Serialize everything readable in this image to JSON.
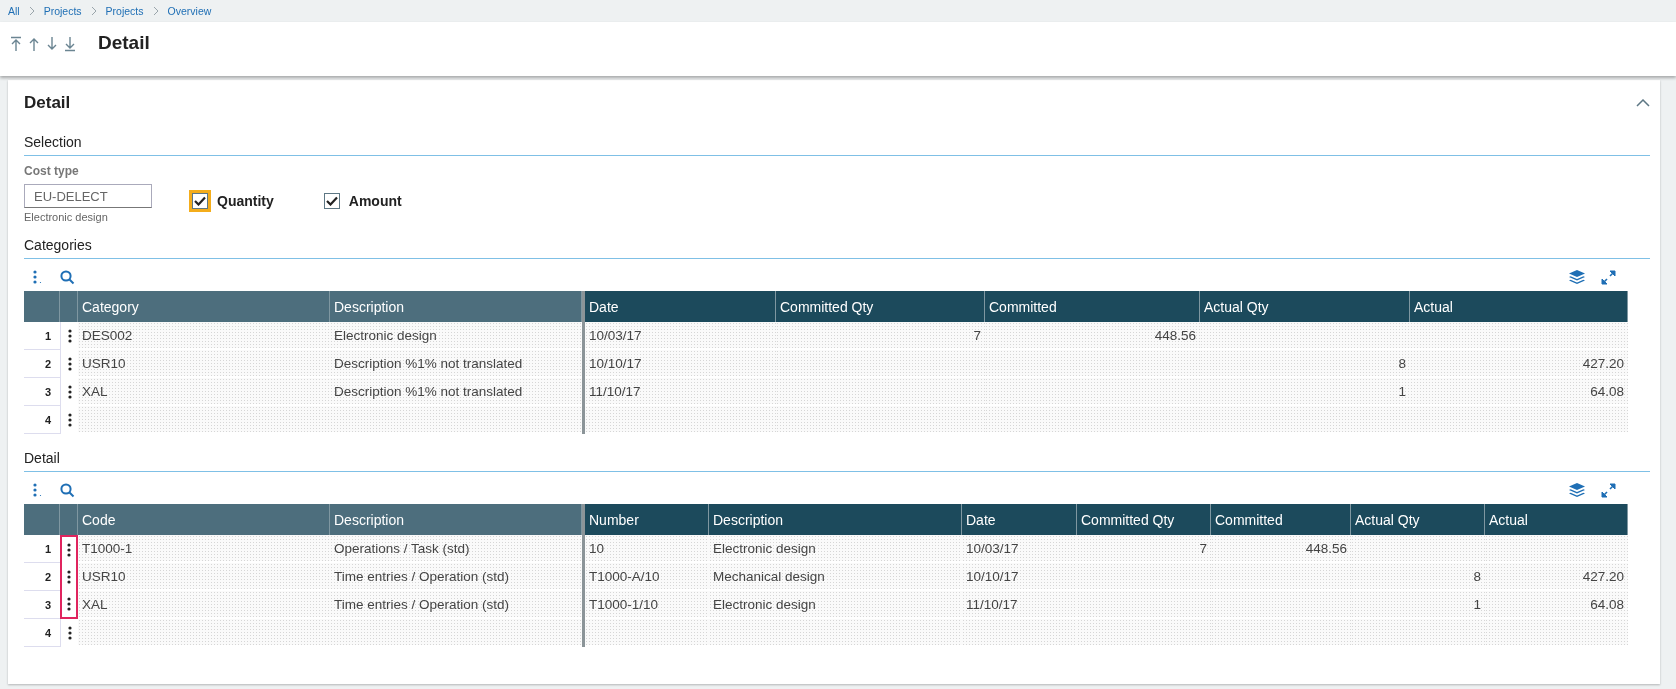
{
  "breadcrumbs": [
    "All",
    "Projects",
    "Projects",
    "Overview"
  ],
  "header": {
    "title": "Detail"
  },
  "section": {
    "title": "Detail",
    "expanded": true,
    "selection": {
      "heading": "Selection",
      "cost_type": {
        "label": "Cost type",
        "value": "EU-DELECT",
        "description": "Electronic design"
      },
      "checkboxes": [
        {
          "label": "Quantity",
          "checked": true,
          "focused": true
        },
        {
          "label": "Amount",
          "checked": true,
          "focused": false
        }
      ]
    },
    "tables": [
      {
        "heading": "Categories",
        "columns": [
          {
            "label": "Category",
            "frozen": true,
            "numeric": false
          },
          {
            "label": "Description",
            "frozen": true,
            "numeric": false
          },
          {
            "label": "Date",
            "frozen": false,
            "numeric": false
          },
          {
            "label": "Committed Qty",
            "frozen": false,
            "numeric": true
          },
          {
            "label": "Committed",
            "frozen": false,
            "numeric": true
          },
          {
            "label": "Actual Qty",
            "frozen": false,
            "numeric": true
          },
          {
            "label": "Actual",
            "frozen": false,
            "numeric": true
          }
        ],
        "rows": [
          {
            "number": "1",
            "marked": false,
            "cells": [
              "DES002",
              "Electronic design",
              "10/03/17",
              "7",
              "448.56",
              null,
              null
            ]
          },
          {
            "number": "2",
            "marked": false,
            "cells": [
              "USR10",
              "Description %1% not translated",
              "10/10/17",
              null,
              null,
              "8",
              "427.20"
            ]
          },
          {
            "number": "3",
            "marked": false,
            "cells": [
              "XAL",
              "Description %1% not translated",
              "11/10/17",
              null,
              null,
              "1",
              "64.08"
            ]
          },
          {
            "number": "4",
            "marked": false,
            "cells": [
              null,
              null,
              null,
              null,
              null,
              null,
              null
            ]
          }
        ]
      },
      {
        "heading": "Detail",
        "columns": [
          {
            "label": "Code",
            "frozen": true,
            "numeric": false
          },
          {
            "label": "Description",
            "frozen": true,
            "numeric": false
          },
          {
            "label": "Number",
            "frozen": false,
            "numeric": false
          },
          {
            "label": "Description",
            "frozen": false,
            "numeric": false
          },
          {
            "label": "Date",
            "frozen": false,
            "numeric": false
          },
          {
            "label": "Committed Qty",
            "frozen": false,
            "numeric": true
          },
          {
            "label": "Committed",
            "frozen": false,
            "numeric": true
          },
          {
            "label": "Actual Qty",
            "frozen": false,
            "numeric": true
          },
          {
            "label": "Actual",
            "frozen": false,
            "numeric": true
          }
        ],
        "rows": [
          {
            "number": "1",
            "marked": true,
            "cells": [
              "T1000-1",
              "Operations / Task (std)",
              "10",
              "Electronic design",
              "10/03/17",
              "7",
              "448.56",
              null,
              null
            ]
          },
          {
            "number": "2",
            "marked": true,
            "cells": [
              "USR10",
              "Time entries / Operation (std)",
              "T1000-A/10",
              "Mechanical design",
              "10/10/17",
              null,
              null,
              "8",
              "427.20"
            ]
          },
          {
            "number": "3",
            "marked": true,
            "cells": [
              "XAL",
              "Time entries / Operation (std)",
              "T1000-1/10",
              "Electronic design",
              "11/10/17",
              null,
              null,
              "1",
              "64.08"
            ]
          },
          {
            "number": "4",
            "marked": false,
            "cells": [
              null,
              null,
              null,
              null,
              null,
              null,
              null,
              null,
              null
            ]
          }
        ]
      }
    ]
  }
}
